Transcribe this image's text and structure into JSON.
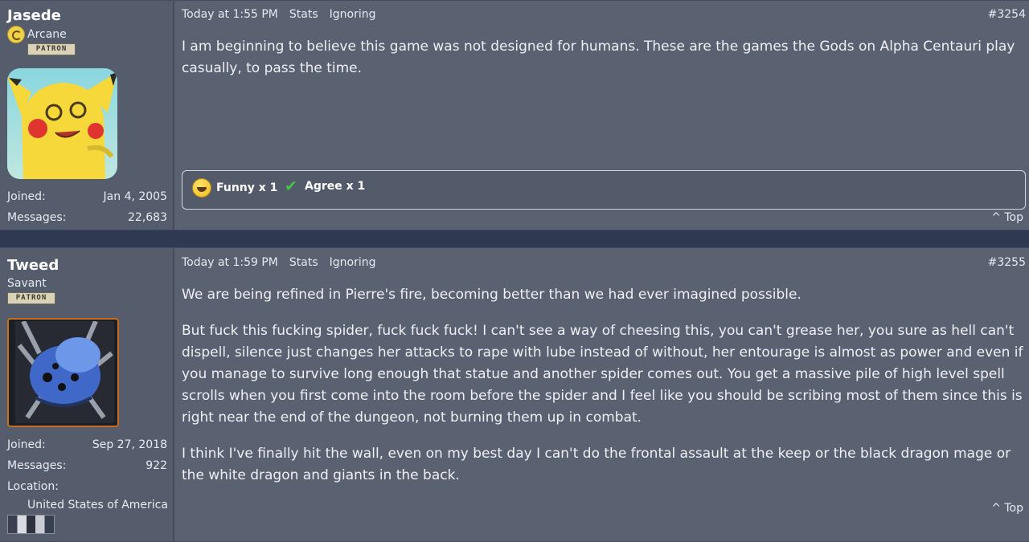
{
  "posts": [
    {
      "username": "Jasede",
      "rank": "Arcane",
      "badge": "PATRON",
      "joined_label": "Joined:",
      "joined": "Jan 4, 2005",
      "messages_label": "Messages:",
      "messages": "22,683",
      "time": "Today at 1:55 PM",
      "stats_label": "Stats",
      "ignoring_label": "Ignoring",
      "post_number": "#3254",
      "paragraphs": [
        "I am beginning to believe this game was not designed for humans. These are the games the Gods on Alpha Centauri play casually, to pass the time."
      ],
      "reactions": [
        {
          "label": "Funny x 1",
          "icon": "laughing-smiley-icon"
        },
        {
          "label": "Agree x 1",
          "icon": "checkmark-icon"
        }
      ],
      "top_label": "^ Top"
    },
    {
      "username": "Tweed",
      "rank": "Savant",
      "badge": "PATRON",
      "joined_label": "Joined:",
      "joined": "Sep 27, 2018",
      "messages_label": "Messages:",
      "messages": "922",
      "location_label": "Location:",
      "location": "United States of America",
      "time": "Today at 1:59 PM",
      "stats_label": "Stats",
      "ignoring_label": "Ignoring",
      "post_number": "#3255",
      "paragraphs": [
        "We are being refined in Pierre's fire, becoming better than we had ever imagined possible.",
        "But fuck this fucking spider, fuck fuck fuck! I can't see a way of cheesing this, you can't grease her, you sure as hell can't dispell, silence just changes her attacks to rape with lube instead of without, her entourage is almost as power and even if you manage to survive long enough that statue and another spider comes out. You get a massive pile of high level spell scrolls when you first come into the room before the spider and I feel like you should be scribing most of them since this is right near the end of the dungeon, not burning them up in combat.",
        "I think I've finally hit the wall, even on my best day I can't do the frontal assault at the keep or the black dragon mage or the white dragon and giants in the back."
      ],
      "top_label": "^ Top"
    }
  ]
}
